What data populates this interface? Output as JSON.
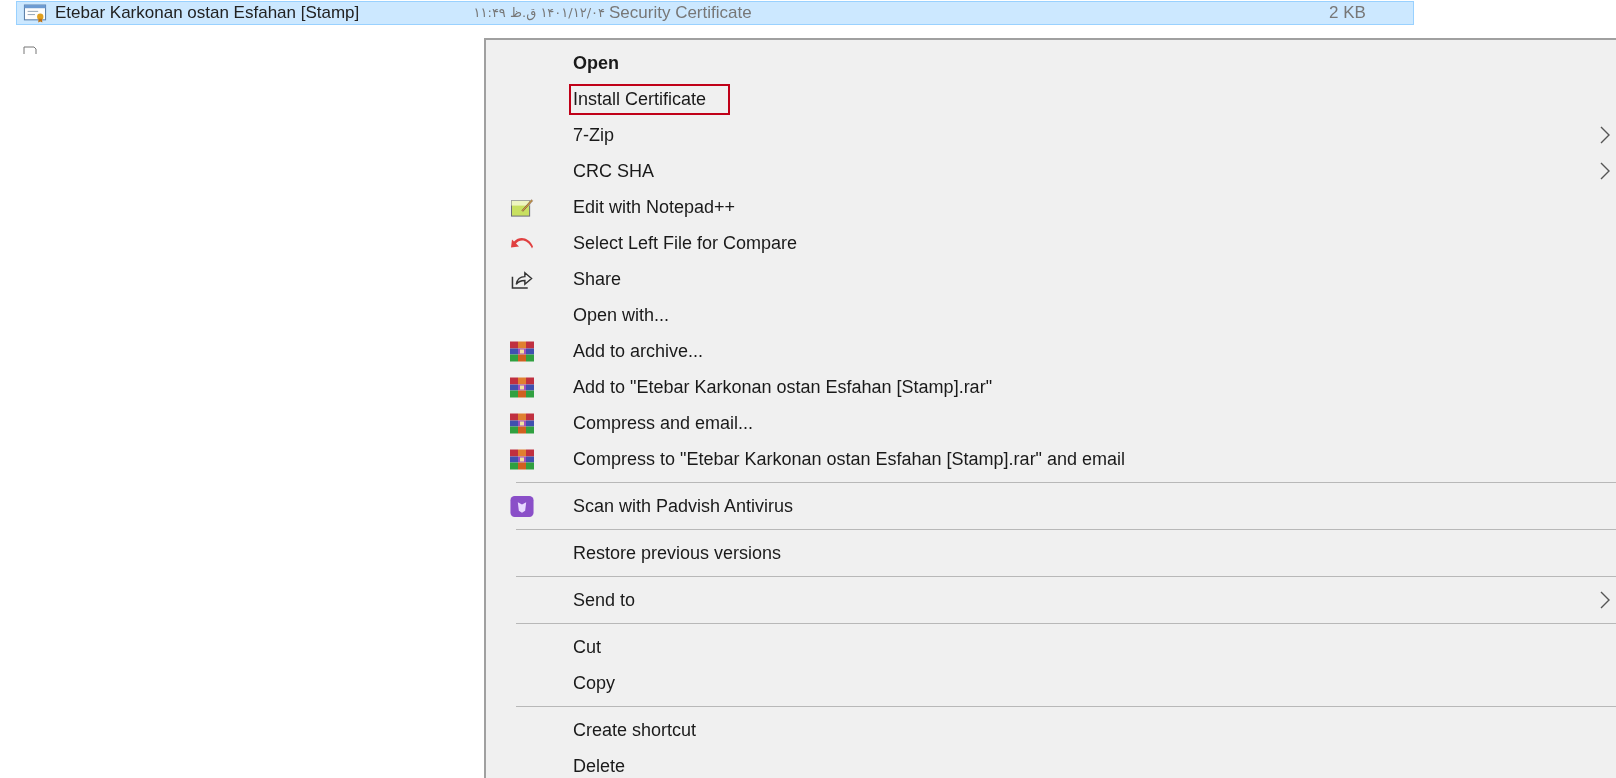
{
  "file_row": {
    "name": "Etebar Karkonan ostan Esfahan [Stamp]",
    "date": "۱۴۰۱/۱۲/۰۴ ق.ظ ۱۱:۴۹",
    "type": "Security Certificate",
    "size": "2 KB",
    "selected": true
  },
  "menu": {
    "groups": [
      {
        "items": [
          {
            "label": "Open",
            "bold": true,
            "outlined": false,
            "submenu": false
          },
          {
            "label": "Install Certificate",
            "bold": false,
            "outlined": true,
            "submenu": false
          },
          {
            "label": "7-Zip",
            "bold": false,
            "outlined": false,
            "submenu": true
          },
          {
            "label": "CRC SHA",
            "bold": false,
            "outlined": false,
            "submenu": true
          },
          {
            "label": "Edit with Notepad++",
            "kind": "notepad",
            "bold": false,
            "outlined": false,
            "submenu": false
          },
          {
            "label": "Select Left File for Compare",
            "kind": "undo",
            "bold": false,
            "outlined": false,
            "submenu": false
          },
          {
            "label": "Share",
            "kind": "share",
            "bold": false,
            "outlined": false,
            "submenu": false
          },
          {
            "label": "Open with...",
            "bold": false,
            "outlined": false,
            "submenu": false
          },
          {
            "label": "Add to archive...",
            "kind": "archive",
            "bold": false,
            "outlined": false,
            "submenu": false
          },
          {
            "label": "Add to \"Etebar Karkonan ostan Esfahan [Stamp].rar\"",
            "kind": "archive",
            "bold": false,
            "outlined": false,
            "submenu": false
          },
          {
            "label": "Compress and email...",
            "kind": "archive",
            "bold": false,
            "outlined": false,
            "submenu": false
          },
          {
            "label": "Compress to \"Etebar Karkonan ostan Esfahan [Stamp].rar\" and email",
            "kind": "archive",
            "bold": false,
            "outlined": false,
            "submenu": false
          }
        ]
      },
      {
        "items": [
          {
            "label": "Scan with Padvish Antivirus",
            "kind": "antivirus",
            "bold": false,
            "outlined": false,
            "submenu": false
          }
        ]
      },
      {
        "items": [
          {
            "label": "Restore previous versions",
            "bold": false,
            "outlined": false,
            "submenu": false
          }
        ]
      },
      {
        "items": [
          {
            "label": "Send to",
            "bold": false,
            "outlined": false,
            "submenu": true
          }
        ]
      },
      {
        "items": [
          {
            "label": "Cut",
            "bold": false,
            "outlined": false,
            "submenu": false
          },
          {
            "label": "Copy",
            "bold": false,
            "outlined": false,
            "submenu": false
          }
        ]
      },
      {
        "items": [
          {
            "label": "Create shortcut",
            "bold": false,
            "outlined": false,
            "submenu": false
          },
          {
            "label": "Delete",
            "bold": false,
            "outlined": false,
            "submenu": false
          }
        ]
      }
    ]
  }
}
